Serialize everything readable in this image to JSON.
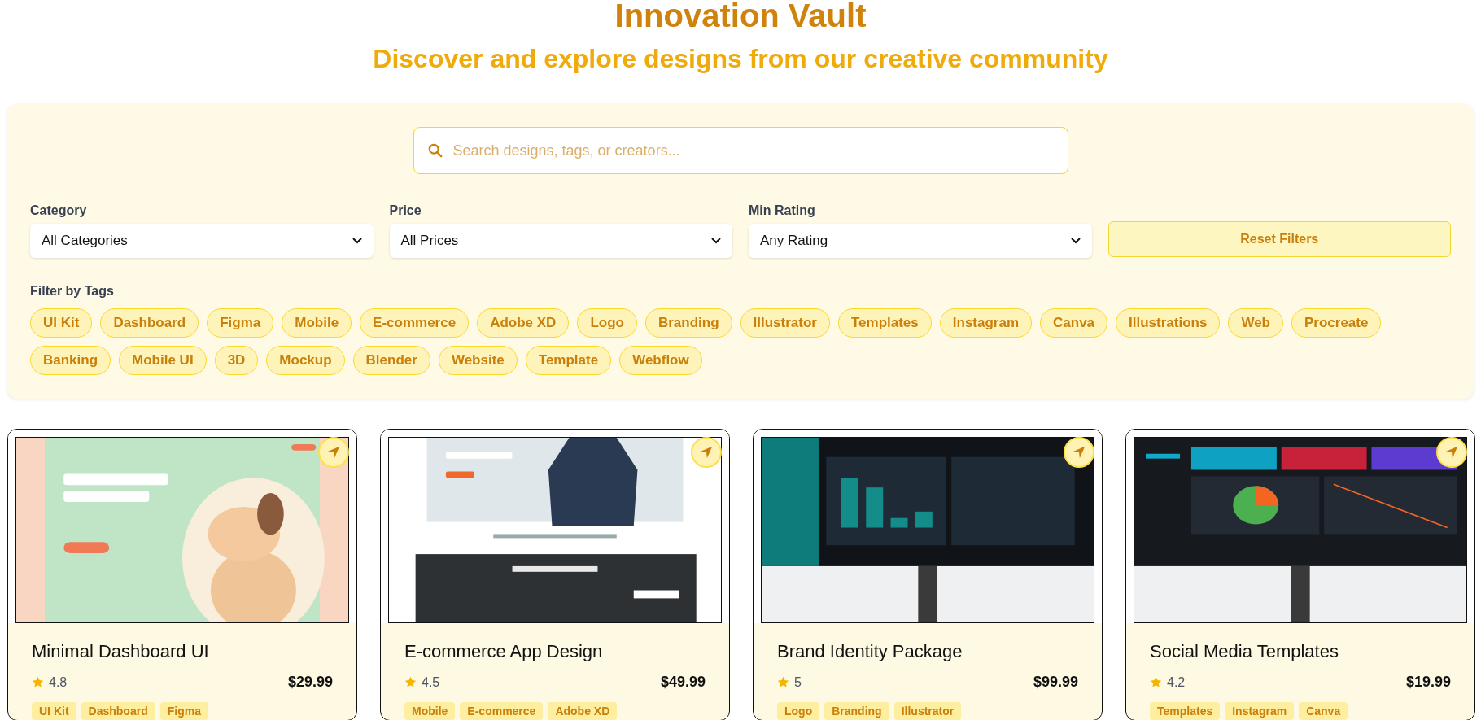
{
  "header": {
    "title": "Innovation Vault",
    "subtitle": "Discover and explore designs from our creative community"
  },
  "search": {
    "placeholder": "Search designs, tags, or creators..."
  },
  "filters": [
    {
      "label": "Category",
      "value": "All Categories"
    },
    {
      "label": "Price",
      "value": "All Prices"
    },
    {
      "label": "Min Rating",
      "value": "Any Rating"
    }
  ],
  "reset_button": "Reset Filters",
  "tags_label": "Filter by Tags",
  "tags": [
    {
      "label": "UI Kit",
      "selected": false
    },
    {
      "label": "Dashboard",
      "selected": false
    },
    {
      "label": "Figma",
      "selected": false
    },
    {
      "label": "Mobile",
      "selected": false
    },
    {
      "label": "E-commerce",
      "selected": false
    },
    {
      "label": "Adobe XD",
      "selected": false
    },
    {
      "label": "Logo",
      "selected": false
    },
    {
      "label": "Branding",
      "selected": false
    },
    {
      "label": "Illustrator",
      "selected": false
    },
    {
      "label": "Templates",
      "selected": false
    },
    {
      "label": "Instagram",
      "selected": false
    },
    {
      "label": "Canva",
      "selected": false
    },
    {
      "label": "Illustrations",
      "selected": false
    },
    {
      "label": "Web",
      "selected": false
    },
    {
      "label": "Procreate",
      "selected": false
    },
    {
      "label": "Banking",
      "selected": false
    },
    {
      "label": "Mobile UI",
      "selected": false
    },
    {
      "label": "3D",
      "selected": false
    },
    {
      "label": "Mockup",
      "selected": false
    },
    {
      "label": "Blender",
      "selected": false
    },
    {
      "label": "Website",
      "selected": false
    },
    {
      "label": "Template",
      "selected": false
    },
    {
      "label": "Webflow",
      "selected": false
    }
  ],
  "cards": [
    {
      "title": "Minimal Dashboard UI",
      "rating": "4.8",
      "price": "$29.99",
      "tags": [
        "UI Kit",
        "Dashboard",
        "Figma"
      ]
    },
    {
      "title": "E-commerce App Design",
      "rating": "4.5",
      "price": "$49.99",
      "tags": [
        "Mobile",
        "E-commerce",
        "Adobe XD"
      ]
    },
    {
      "title": "Brand Identity Package",
      "rating": "5",
      "price": "$99.99",
      "tags": [
        "Logo",
        "Branding",
        "Illustrator"
      ]
    },
    {
      "title": "Social Media Templates",
      "rating": "4.2",
      "price": "$19.99",
      "tags": [
        "Templates",
        "Instagram",
        "Canva"
      ]
    }
  ]
}
